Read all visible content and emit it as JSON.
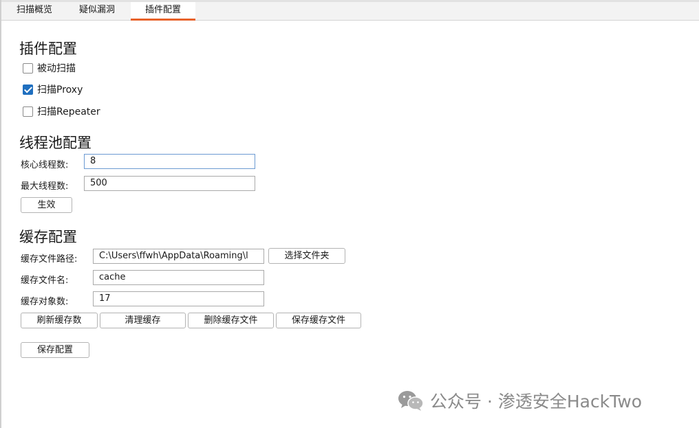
{
  "tabs": [
    {
      "label": "扫描概览",
      "active": false
    },
    {
      "label": "疑似漏洞",
      "active": false
    },
    {
      "label": "插件配置",
      "active": true
    }
  ],
  "plugin": {
    "title": "插件配置",
    "passive_scan": {
      "label": "被动扫描",
      "checked": false
    },
    "scan_proxy": {
      "label": "扫描Proxy",
      "checked": true
    },
    "scan_repeater": {
      "label": "扫描Repeater",
      "checked": false
    }
  },
  "threadpool": {
    "title": "线程池配置",
    "core_label": "核心线程数:",
    "core_value": "8",
    "max_label": "最大线程数:",
    "max_value": "500",
    "apply_label": "生效"
  },
  "cache": {
    "title": "缓存配置",
    "path_label": "缓存文件路径:",
    "path_value": "C:\\Users\\ffwh\\AppData\\Roaming\\l",
    "choose_folder_label": "选择文件夹",
    "name_label": "缓存文件名:",
    "name_value": "cache",
    "count_label": "缓存对象数:",
    "count_value": "17",
    "refresh_label": "刷新缓存数",
    "clear_label": "清理缓存",
    "delete_label": "删除缓存文件",
    "save_file_label": "保存缓存文件"
  },
  "save_config_label": "保存配置",
  "watermark": {
    "text": "公众号 · 渗透安全HackTwo",
    "icon": "wechat-icon"
  },
  "colors": {
    "accent": "#e8622a",
    "checkbox": "#1f6fbf",
    "focus_border": "#6b9ad2"
  }
}
